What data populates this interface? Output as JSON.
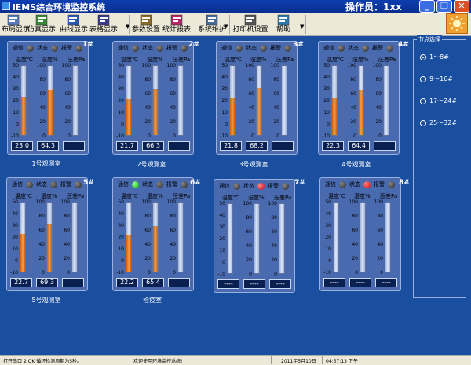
{
  "window": {
    "title": "iEMS综合环境监控系统",
    "operator": "操作员：1xx"
  },
  "toolbar": {
    "items": [
      {
        "label": "布局显示",
        "icon": "layout-icon"
      },
      {
        "label": "仿真显示",
        "icon": "simulation-icon"
      },
      {
        "label": "曲线显示",
        "icon": "curve-icon"
      },
      {
        "label": "表格显示",
        "icon": "table-icon"
      },
      {
        "label": "参数设置",
        "icon": "parameter-icon"
      },
      {
        "label": "统计报表",
        "icon": "report-icon"
      },
      {
        "label": "系统维护",
        "icon": "maintenance-icon"
      },
      {
        "label": "打印机设置",
        "icon": "printer-icon"
      },
      {
        "label": "帮助",
        "icon": "help-icon"
      }
    ]
  },
  "headers": {
    "comm": "通信",
    "state": "状态",
    "alarm": "报警",
    "temp": "温度℃",
    "humid": "湿度%",
    "pressure": "压差Pa"
  },
  "scales": {
    "temp": [
      "50",
      "40",
      "30",
      "20",
      "10",
      "0",
      "-10"
    ],
    "humid": [
      "100",
      "80",
      "60",
      "40",
      "20",
      "0"
    ],
    "pressure": [
      "100",
      "80",
      "60",
      "40",
      "20",
      "0"
    ]
  },
  "rooms": [
    {
      "num": "1#",
      "name": "1号观测室",
      "temp": "23.0",
      "humid": "64.3",
      "pressure": "",
      "comm": "off",
      "state": "off",
      "alarm": "off"
    },
    {
      "num": "2#",
      "name": "2号观测室",
      "temp": "21.7",
      "humid": "66.3",
      "pressure": "",
      "comm": "off",
      "state": "off",
      "alarm": "off"
    },
    {
      "num": "3#",
      "name": "3号观测室",
      "temp": "21.8",
      "humid": "68.2",
      "pressure": "",
      "comm": "off",
      "state": "off",
      "alarm": "off"
    },
    {
      "num": "4#",
      "name": "4号观测室",
      "temp": "22.3",
      "humid": "64.4",
      "pressure": "",
      "comm": "off",
      "state": "off",
      "alarm": "off"
    },
    {
      "num": "5#",
      "name": "5号观测室",
      "temp": "22.7",
      "humid": "69.3",
      "pressure": "",
      "comm": "off",
      "state": "off",
      "alarm": "off"
    },
    {
      "num": "6#",
      "name": "检疫室",
      "temp": "22.2",
      "humid": "65.4",
      "pressure": "",
      "comm": "on",
      "state": "off",
      "alarm": "off"
    },
    {
      "num": "7#",
      "name": "",
      "temp": "----",
      "humid": "----",
      "pressure": "----",
      "comm": "off",
      "state": "alarm",
      "alarm": "off"
    },
    {
      "num": "8#",
      "name": "",
      "temp": "----",
      "humid": "----",
      "pressure": "----",
      "comm": "off",
      "state": "alarm",
      "alarm": "off"
    }
  ],
  "side": {
    "title": "节点选择",
    "options": [
      "1～8#",
      "9～16#",
      "17～24#",
      "25～32#"
    ],
    "selected_index": 0
  },
  "status": {
    "port": "打开串口 2 OK 循环检测周期为5秒。",
    "msg": "欢迎使用环境监控系统!",
    "date": "2011年5月10日",
    "time": "04:57:13 下午"
  }
}
